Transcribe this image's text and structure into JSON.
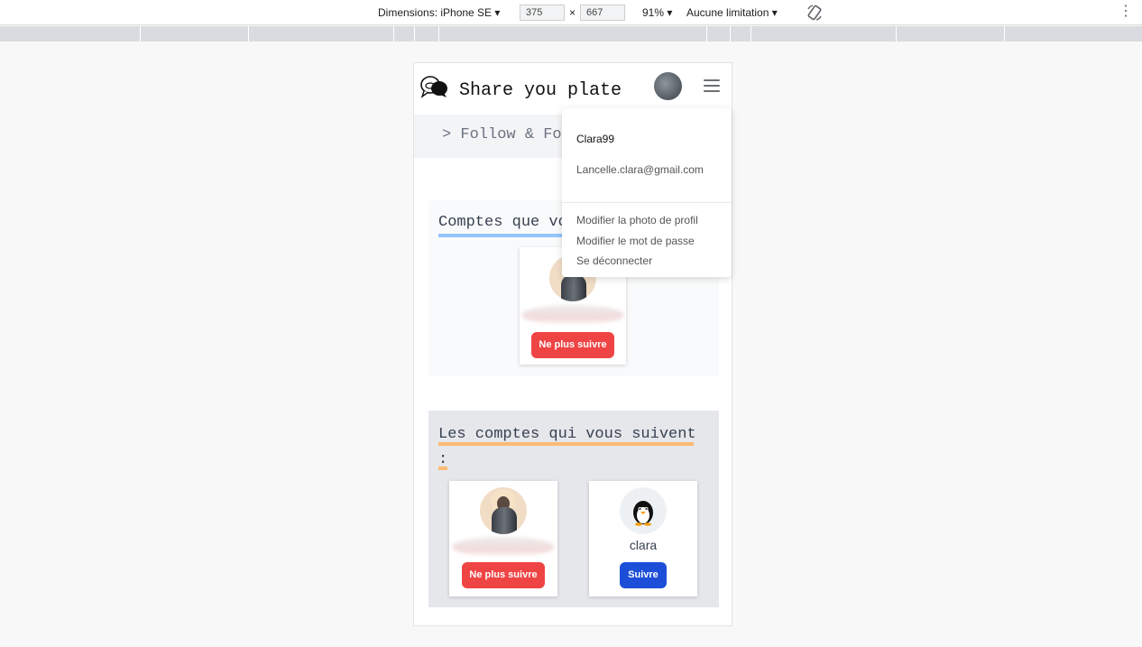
{
  "devtools": {
    "device_label": "Dimensions: iPhone SE",
    "width": "375",
    "height": "667",
    "times": "×",
    "zoom": "91%",
    "throttle": "Aucune limitation"
  },
  "header": {
    "brand": "Share you plate"
  },
  "breadcrumb": {
    "text": "> Follow & Fo"
  },
  "following": {
    "title": "Comptes que vo",
    "cards": [
      {
        "name": "",
        "button": "Ne plus suivre"
      }
    ]
  },
  "followers": {
    "title": "Les comptes qui vous suivent :",
    "cards": [
      {
        "name": "",
        "button": "Ne plus suivre"
      },
      {
        "name": "clara",
        "button": "Suivre"
      }
    ]
  },
  "dropdown": {
    "username": "Clara99",
    "email": "Lancelle.clara@gmail.com",
    "items": [
      "Modifier la photo de profil",
      "Modifier le mot de passe",
      "Se déconnecter"
    ]
  },
  "colors": {
    "unfollow": "#ef4444",
    "follow": "#1d4ed8",
    "underline_following": "#93c5fd",
    "underline_followers": "#fdba74"
  }
}
